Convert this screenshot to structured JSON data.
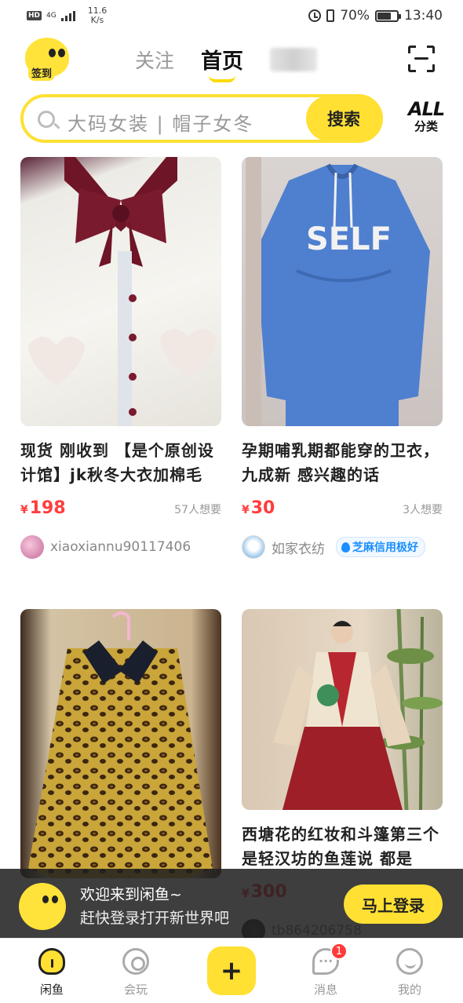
{
  "status_bar": {
    "net_type": "4G",
    "speed": "11.6",
    "speed_unit": "K/s",
    "battery": "70%",
    "time": "13:40"
  },
  "header": {
    "checkin_label": "签到",
    "tabs": [
      {
        "label": "关注"
      },
      {
        "label": "首页"
      }
    ]
  },
  "search": {
    "placeholder": "大码女装 | 帽子女冬",
    "button": "搜索"
  },
  "all_category": {
    "top": "ALL",
    "bottom": "分类"
  },
  "products": [
    {
      "title": "现货 刚收到 【是个原创设计馆】jk秋冬大衣加棉毛",
      "currency": "¥",
      "price": "198",
      "wants": "57人想要",
      "seller": "xiaoxiannu90117406",
      "credit": ""
    },
    {
      "title": "孕期哺乳期都能穿的卫衣，九成新 感兴趣的话",
      "currency": "¥",
      "price": "30",
      "wants": "3人想要",
      "seller": "如家衣纺",
      "credit": "芝麻信用极好"
    },
    {
      "title": "",
      "currency": "",
      "price": "",
      "wants": "",
      "seller": "",
      "credit": ""
    },
    {
      "title": "西塘花的红妆和斗篷第三个是轻汉坊的鱼莲说 都是",
      "currency": "¥",
      "price": "300",
      "wants": "",
      "seller": "tb864206758",
      "credit": ""
    }
  ],
  "login_banner": {
    "title": "欢迎来到闲鱼~",
    "subtitle": "赶快登录打开新世界吧",
    "button": "马上登录"
  },
  "bottom_nav": [
    {
      "label": "闲鱼",
      "icon": "xianyu-home-icon"
    },
    {
      "label": "会玩",
      "icon": "play-icon"
    },
    {
      "label": "",
      "icon": "plus-icon"
    },
    {
      "label": "消息",
      "icon": "message-icon",
      "badge": "1"
    },
    {
      "label": "我的",
      "icon": "profile-icon"
    }
  ],
  "colors": {
    "accent": "#ffe033",
    "price": "#ff3d3d",
    "credit": "#1a8fff"
  }
}
